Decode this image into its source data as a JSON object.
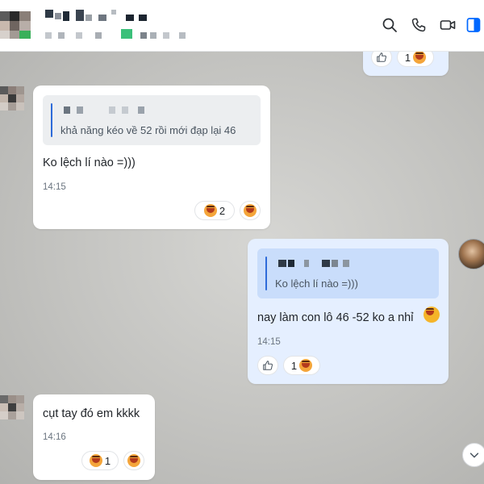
{
  "header": {
    "icons": [
      "search-icon",
      "phone-icon",
      "video-icon",
      "panel-toggle-icon"
    ],
    "accent_color": "#0068ff"
  },
  "messages": [
    {
      "id": "m0",
      "sender": "me",
      "reactions": [
        {
          "icon": "thumbs-up-icon",
          "count": ""
        },
        {
          "icon": "laughing-emoji-icon",
          "count": "1"
        }
      ]
    },
    {
      "id": "m1",
      "sender": "other",
      "quote": {
        "text": "khả năng kéo về 52 rồi mới đạp lại 46"
      },
      "text": "Ko lệch lí nào =)))",
      "time": "14:15",
      "reactions": [
        {
          "icon": "laughing-emoji-icon",
          "count": "2"
        },
        {
          "icon": "laughing-emoji-icon",
          "count": ""
        }
      ]
    },
    {
      "id": "m2",
      "sender": "me",
      "quote": {
        "text": "Ko lệch lí nào =)))"
      },
      "text": "nay làm con lô 46 -52 ko a nhỉ",
      "time": "14:15",
      "reactions": [
        {
          "icon": "thumbs-up-icon",
          "count": ""
        },
        {
          "icon": "laughing-emoji-icon",
          "count": "1"
        }
      ]
    },
    {
      "id": "m3",
      "sender": "other",
      "text": "cụt tay đó em kkkk",
      "time": "14:16",
      "reactions": [
        {
          "icon": "laughing-emoji-icon",
          "count": "1"
        },
        {
          "icon": "laughing-emoji-icon",
          "count": ""
        }
      ]
    }
  ]
}
